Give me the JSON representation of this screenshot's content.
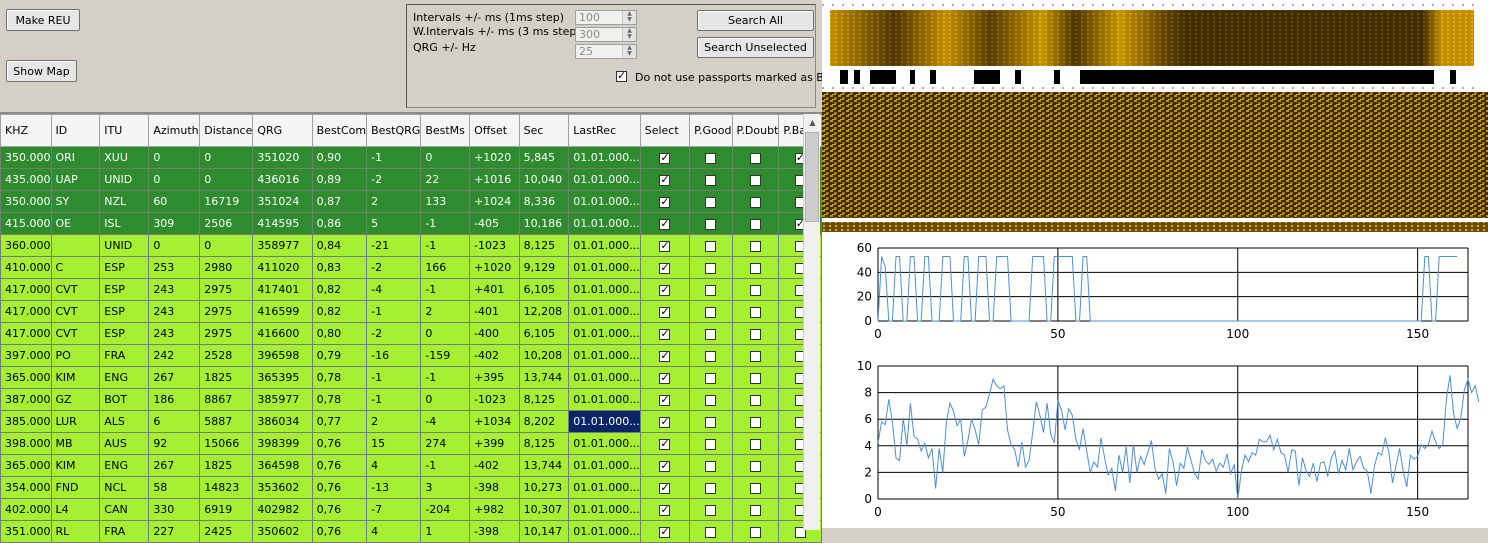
{
  "buttons": {
    "make_reu": "Make REU",
    "show_map": "Show Map",
    "search_all": "Search All",
    "search_unselected": "Search Unselected"
  },
  "params": {
    "intervals_label": "Intervals +/- ms (1ms step)",
    "intervals_value": "100",
    "w_intervals_label": "W.Intervals +/- ms (3 ms step)",
    "w_intervals_value": "300",
    "qrg_label": "QRG +/- Hz",
    "qrg_value": "25",
    "bad_passports_label": "Do not use passports marked as Bad",
    "bad_passports_checked": true
  },
  "grid": {
    "columns": [
      "KHZ",
      "ID",
      "ITU",
      "Azimuth",
      "Distance",
      "QRG",
      "BestCom",
      "BestQRG",
      "BestMs",
      "Offset",
      "Sec",
      "LastRec",
      "Select",
      "P.Good",
      "P.Doubt",
      "P.Bad"
    ],
    "rows": [
      {
        "style": "dark",
        "cells": [
          "350.000",
          "ORI",
          "XUU",
          "0",
          "0",
          "351020",
          "0,90",
          "-1",
          "0",
          "+1020",
          "5,845",
          "01.01.000..."
        ],
        "select": true,
        "pgood": false,
        "pdoubt": false,
        "pbad": true
      },
      {
        "style": "dark",
        "cells": [
          "435.000",
          "UAP",
          "UNID",
          "0",
          "0",
          "436016",
          "0,89",
          "-2",
          "22",
          "+1016",
          "10,040",
          "01.01.000..."
        ],
        "select": true,
        "pgood": false,
        "pdoubt": false,
        "pbad": false
      },
      {
        "style": "dark",
        "cells": [
          "350.000",
          "SY",
          "NZL",
          "60",
          "16719",
          "351024",
          "0,87",
          "2",
          "133",
          "+1024",
          "8,336",
          "01.01.000..."
        ],
        "select": true,
        "pgood": false,
        "pdoubt": false,
        "pbad": false
      },
      {
        "style": "dark",
        "cells": [
          "415.000",
          "OE",
          "ISL",
          "309",
          "2506",
          "414595",
          "0,86",
          "5",
          "-1",
          "-405",
          "10,186",
          "01.01.000..."
        ],
        "select": true,
        "pgood": false,
        "pdoubt": false,
        "pbad": true
      },
      {
        "style": "light",
        "cells": [
          "360.000",
          "",
          "UNID",
          "0",
          "0",
          "358977",
          "0,84",
          "-21",
          "-1",
          "-1023",
          "8,125",
          "01.01.000..."
        ],
        "select": true,
        "pgood": false,
        "pdoubt": false,
        "pbad": false
      },
      {
        "style": "light",
        "cells": [
          "410.000",
          "C",
          "ESP",
          "253",
          "2980",
          "411020",
          "0,83",
          "-2",
          "166",
          "+1020",
          "9,129",
          "01.01.000..."
        ],
        "select": true,
        "pgood": false,
        "pdoubt": false,
        "pbad": false
      },
      {
        "style": "light",
        "cells": [
          "417.000",
          "CVT",
          "ESP",
          "243",
          "2975",
          "417401",
          "0,82",
          "-4",
          "-1",
          "+401",
          "6,105",
          "01.01.000..."
        ],
        "select": true,
        "pgood": false,
        "pdoubt": false,
        "pbad": false
      },
      {
        "style": "light",
        "cells": [
          "417.000",
          "CVT",
          "ESP",
          "243",
          "2975",
          "416599",
          "0,82",
          "-1",
          "2",
          "-401",
          "12,208",
          "01.01.000..."
        ],
        "select": true,
        "pgood": false,
        "pdoubt": false,
        "pbad": false
      },
      {
        "style": "light",
        "cells": [
          "417.000",
          "CVT",
          "ESP",
          "243",
          "2975",
          "416600",
          "0,80",
          "-2",
          "0",
          "-400",
          "6,105",
          "01.01.000..."
        ],
        "select": true,
        "pgood": false,
        "pdoubt": false,
        "pbad": false
      },
      {
        "style": "light",
        "cells": [
          "397.000",
          "PO",
          "FRA",
          "242",
          "2528",
          "396598",
          "0,79",
          "-16",
          "-159",
          "-402",
          "10,208",
          "01.01.000..."
        ],
        "select": true,
        "pgood": false,
        "pdoubt": false,
        "pbad": false
      },
      {
        "style": "light",
        "cells": [
          "365.000",
          "KIM",
          "ENG",
          "267",
          "1825",
          "365395",
          "0,78",
          "-1",
          "-1",
          "+395",
          "13,744",
          "01.01.000..."
        ],
        "select": true,
        "pgood": false,
        "pdoubt": false,
        "pbad": false
      },
      {
        "style": "light",
        "cells": [
          "387.000",
          "GZ",
          "BOT",
          "186",
          "8867",
          "385977",
          "0,78",
          "-1",
          "0",
          "-1023",
          "8,125",
          "01.01.000..."
        ],
        "select": true,
        "pgood": false,
        "pdoubt": false,
        "pbad": false
      },
      {
        "style": "light",
        "cells": [
          "385.000",
          "LUR",
          "ALS",
          "6",
          "5887",
          "386034",
          "0,77",
          "2",
          "-4",
          "+1034",
          "8,202",
          "01.01.000..."
        ],
        "select": true,
        "pgood": false,
        "pdoubt": false,
        "pbad": false,
        "selected_cell": 11
      },
      {
        "style": "light",
        "cells": [
          "398.000",
          "MB",
          "AUS",
          "92",
          "15066",
          "398399",
          "0,76",
          "15",
          "274",
          "+399",
          "8,125",
          "01.01.000..."
        ],
        "select": true,
        "pgood": false,
        "pdoubt": false,
        "pbad": false
      },
      {
        "style": "light",
        "cells": [
          "365.000",
          "KIM",
          "ENG",
          "267",
          "1825",
          "364598",
          "0,76",
          "4",
          "-1",
          "-402",
          "13,744",
          "01.01.000..."
        ],
        "select": true,
        "pgood": false,
        "pdoubt": false,
        "pbad": false
      },
      {
        "style": "light",
        "cells": [
          "354.000",
          "FND",
          "NCL",
          "58",
          "14823",
          "353602",
          "0,76",
          "-13",
          "3",
          "-398",
          "10,273",
          "01.01.000..."
        ],
        "select": true,
        "pgood": false,
        "pdoubt": false,
        "pbad": false
      },
      {
        "style": "light",
        "cells": [
          "402.000",
          "L4",
          "CAN",
          "330",
          "6919",
          "402982",
          "0,76",
          "-7",
          "-204",
          "+982",
          "10,307",
          "01.01.000..."
        ],
        "select": true,
        "pgood": false,
        "pdoubt": false,
        "pbad": false
      },
      {
        "style": "light",
        "cells": [
          "351.000",
          "RL",
          "FRA",
          "227",
          "2425",
          "350602",
          "0,76",
          "4",
          "1",
          "-398",
          "10,147",
          "01.01.000..."
        ],
        "select": true,
        "pgood": false,
        "pdoubt": false,
        "pbad": false
      }
    ]
  },
  "colors": {
    "dark_row": "#2e8b2e",
    "light_row": "#a4f031",
    "selected_cell": "#0a246a",
    "series": "#4a90d9",
    "spectro_hi": "#e8a800",
    "spectro_lo": "#2a1c00"
  },
  "chart_data": [
    {
      "type": "line",
      "x_ticks": [
        0,
        50,
        100,
        150
      ],
      "y_ticks": [
        0,
        20,
        40,
        60
      ],
      "xlim": [
        0,
        164
      ],
      "ylim": [
        0,
        60
      ],
      "grid": true,
      "series": [
        {
          "values": [
            0,
            53,
            45,
            0,
            0,
            53,
            53,
            0,
            0,
            53,
            53,
            0,
            0,
            53,
            53,
            0,
            0,
            0,
            53,
            53,
            53,
            0,
            0,
            0,
            53,
            53,
            0,
            0,
            53,
            53,
            53,
            0,
            0,
            53,
            53,
            53,
            53,
            0,
            0,
            0,
            0,
            0,
            0,
            53,
            53,
            53,
            53,
            0,
            0,
            53,
            53,
            53,
            53,
            53,
            53,
            0,
            0,
            53,
            53,
            0,
            0,
            0,
            0,
            0,
            0,
            0,
            0,
            0,
            0,
            0,
            0,
            0,
            0,
            0,
            0,
            0,
            0,
            0,
            0,
            0,
            0,
            0,
            0,
            0,
            0,
            0,
            0,
            0,
            0,
            0,
            0,
            0,
            0,
            0,
            0,
            0,
            0,
            0,
            0,
            0,
            0,
            0,
            0,
            0,
            0,
            0,
            0,
            0,
            0,
            0,
            0,
            0,
            0,
            0,
            0,
            0,
            0,
            0,
            0,
            0,
            0,
            0,
            0,
            0,
            0,
            0,
            0,
            0,
            0,
            0,
            0,
            0,
            0,
            0,
            0,
            0,
            0,
            0,
            0,
            0,
            0,
            0,
            0,
            0,
            0,
            0,
            0,
            0,
            0,
            0,
            0,
            0,
            53,
            53,
            0,
            0,
            53,
            53,
            53,
            53,
            53,
            53
          ]
        }
      ]
    },
    {
      "type": "line",
      "x_ticks": [
        0,
        50,
        100,
        150
      ],
      "y_ticks": [
        0,
        2,
        4,
        6,
        8,
        10
      ],
      "xlim": [
        0,
        164
      ],
      "ylim": [
        0,
        10
      ],
      "grid": true,
      "series": [
        {
          "values": [
            4.2,
            5.8,
            5.6,
            7.5,
            5.8,
            3.1,
            2.9,
            6.1,
            4.0,
            7.2,
            4.7,
            4.5,
            3.6,
            4.2,
            3.1,
            3.8,
            0.8,
            3.8,
            2.0,
            5.8,
            7.2,
            6.6,
            5.5,
            6.0,
            3.2,
            4.4,
            6.0,
            5.2,
            4.1,
            6.7,
            6.9,
            7.9,
            9.0,
            8.5,
            8.3,
            8.5,
            5.2,
            4.1,
            3.7,
            2.4,
            4.3,
            2.4,
            2.9,
            5.0,
            7.3,
            6.3,
            5.0,
            7.2,
            4.9,
            4.2,
            7.4,
            6.7,
            5.2,
            6.8,
            6.3,
            4.5,
            3.7,
            5.3,
            3.6,
            2.0,
            2.8,
            2.4,
            4.6,
            3.1,
            1.8,
            2.3,
            0.6,
            3.3,
            2.0,
            3.9,
            1.2,
            4.1,
            2.0,
            3.2,
            2.6,
            3.5,
            4.4,
            2.3,
            1.5,
            1.9,
            0.4,
            3.8,
            2.8,
            1.0,
            2.7,
            2.3,
            3.9,
            2.9,
            1.9,
            1.5,
            3.7,
            2.9,
            2.6,
            3.0,
            2.1,
            2.7,
            2.4,
            3.4,
            1.9,
            2.6,
            0.0,
            2.1,
            3.3,
            2.8,
            3.5,
            3.3,
            4.5,
            4.3,
            4.3,
            4.8,
            3.7,
            4.5,
            3.5,
            3.3,
            2.0,
            3.7,
            3.6,
            1.0,
            3.1,
            2.1,
            1.7,
            2.7,
            1.3,
            2.7,
            2.8,
            1.7,
            3.1,
            3.6,
            1.9,
            2.9,
            2.2,
            3.8,
            2.2,
            2.8,
            3.2,
            2.3,
            2.1,
            0.4,
            2.5,
            3.5,
            3.3,
            4.6,
            3.5,
            1.2,
            2.5,
            3.8,
            2.1,
            0.9,
            3.3,
            3.0,
            3.2,
            4.1,
            3.8,
            4.1,
            5.1,
            4.3,
            3.8,
            4.1,
            7.5,
            9.3,
            6.4,
            5.3,
            6.1,
            8.2,
            9.0,
            8.0,
            8.5,
            7.3
          ]
        }
      ]
    }
  ]
}
